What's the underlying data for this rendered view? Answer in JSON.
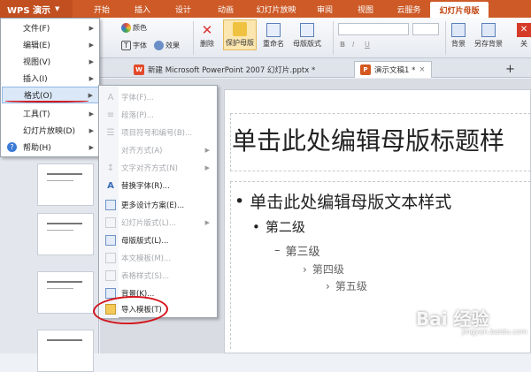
{
  "app_menu": {
    "label": "WPS 演示"
  },
  "ribbon_tabs": [
    "开始",
    "插入",
    "设计",
    "动画",
    "幻灯片放映",
    "审阅",
    "视图",
    "云服务",
    "幻灯片母版"
  ],
  "ribbon": {
    "color_label": "颜色",
    "font_label": "字体",
    "effect_label": "效果",
    "delete_label": "删除",
    "protect_master_label": "保护母版",
    "rename_label": "重命名",
    "master_layout_label": "母版版式",
    "background_label": "背景",
    "save_as_template_label": "另存背景",
    "close_label": "关"
  },
  "doc_tabs": [
    {
      "label": "新建 Microsoft PowerPoint 2007 幻灯片.pptx *"
    },
    {
      "label": "演示文稿1 *"
    }
  ],
  "main_menu": [
    {
      "label": "文件(F)",
      "has_submenu": true
    },
    {
      "label": "编辑(E)",
      "has_submenu": true
    },
    {
      "label": "视图(V)",
      "has_submenu": true
    },
    {
      "label": "插入(I)",
      "has_submenu": true
    },
    {
      "label": "格式(O)",
      "has_submenu": true,
      "highlighted": true
    },
    {
      "label": "工具(T)",
      "has_submenu": true
    },
    {
      "label": "幻灯片放映(D)",
      "has_submenu": true
    },
    {
      "label": "帮助(H)",
      "has_submenu": true
    }
  ],
  "format_submenu": [
    {
      "label": "字体(F)...",
      "enabled": false
    },
    {
      "label": "段落(P)...",
      "enabled": false
    },
    {
      "label": "项目符号和编号(B)...",
      "enabled": false
    },
    {
      "label": "对齐方式(A)",
      "enabled": false,
      "has_submenu": true
    },
    {
      "label": "文字对齐方式(N)",
      "enabled": false,
      "has_submenu": true
    },
    {
      "label": "替换字体(R)...",
      "enabled": true
    },
    {
      "label": "更多设计方案(E)...",
      "enabled": true
    },
    {
      "label": "幻灯片版式(L)...",
      "enabled": false
    },
    {
      "label": "母版版式(L)...",
      "enabled": true
    },
    {
      "label": "本文模板(M)...",
      "enabled": false
    },
    {
      "label": "表格样式(S)...",
      "enabled": false
    },
    {
      "label": "背景(K)...",
      "enabled": true
    },
    {
      "label": "导入模板(T)",
      "enabled": true,
      "circled": true
    }
  ],
  "slide": {
    "title": "单击此处编辑母版标题样",
    "levels": [
      "单击此处编辑母版文本样式",
      "第二级",
      "第三级",
      "第四级",
      "第五级"
    ]
  },
  "thumbnails": [
    {
      "caption": "单击此处编辑母版标题"
    }
  ],
  "watermark": {
    "text": "Bai 经验",
    "url": "jingyan.baidu.com"
  },
  "colors": {
    "accent": "#cd5a27",
    "annotation_red": "#d4141c"
  }
}
